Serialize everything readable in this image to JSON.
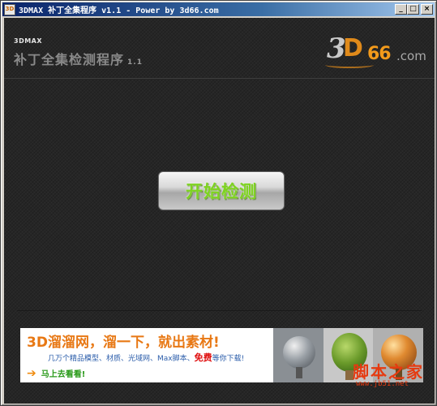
{
  "window": {
    "title": "3DMAX 补丁全集程序 v1.1 - Power by 3d66.com",
    "icon_text": "3D",
    "buttons": {
      "minimize": "_",
      "maximize": "□",
      "close": "×"
    }
  },
  "header": {
    "small_label": "3DMAX",
    "title": "补丁全集检测程序",
    "version": "1.1",
    "logo": {
      "part_3": "3",
      "part_d": "D",
      "part_66": "66",
      "part_com": ".com"
    }
  },
  "main": {
    "start_button_label": "开始检测"
  },
  "banner": {
    "headline": "3D溜溜网，溜一下，就出素材!",
    "sub_before": "几万个精品模型、材质、光域网、Max脚本、",
    "sub_free": "免费",
    "sub_after": "等你下载!",
    "cta_arrow": "➔",
    "cta_label": "马上去看看!",
    "images": [
      "material-sphere-icon",
      "tree-sphere-icon",
      "wood-sphere-icon"
    ]
  },
  "watermark": {
    "main": "脚本之家",
    "url": "www.jb51.net"
  },
  "colors": {
    "client_bg": "#262626",
    "button_text": "#7ed321",
    "banner_headline": "#e87814",
    "banner_free": "#e01010",
    "titlebar_start": "#0a246a",
    "titlebar_end": "#a6caf0"
  }
}
